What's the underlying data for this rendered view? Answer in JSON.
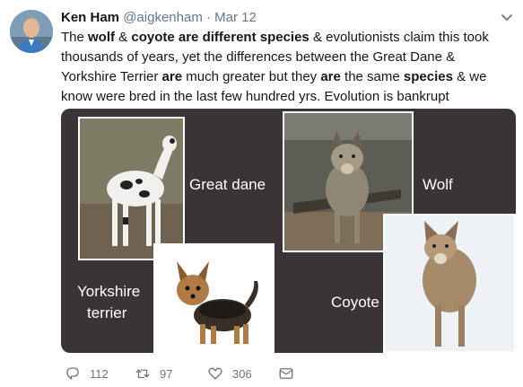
{
  "author": {
    "name": "Ken Ham",
    "handle": "@aigkenham",
    "separator": "·",
    "date": "Mar 12"
  },
  "tweet": {
    "segments": [
      {
        "text": "The ",
        "bold": false
      },
      {
        "text": "wolf",
        "bold": true
      },
      {
        "text": " & ",
        "bold": false
      },
      {
        "text": "coyote are different species",
        "bold": true
      },
      {
        "text": " & evolutionists claim this took thousands of years, yet the differences between the Great Dane & Yorkshire Terrier ",
        "bold": false
      },
      {
        "text": "are",
        "bold": true
      },
      {
        "text": " much greater but they ",
        "bold": false
      },
      {
        "text": "are",
        "bold": true
      },
      {
        "text": " the same ",
        "bold": false
      },
      {
        "text": "species",
        "bold": true
      },
      {
        "text": " & we know were bred in the last few hundred yrs.  Evolution is bankrupt",
        "bold": false
      }
    ]
  },
  "media": {
    "labels": {
      "great_dane": "Great dane",
      "wolf": "Wolf",
      "yorkshire_line1": "Yorkshire",
      "yorkshire_line2": "terrier",
      "coyote": "Coyote"
    }
  },
  "actions": {
    "replies": "112",
    "retweets": "97",
    "likes": "306"
  },
  "colors": {
    "text": "#14171a",
    "muted": "#657786",
    "media_bg": "#3a3436"
  },
  "icons": [
    "chevron-down-icon",
    "reply-icon",
    "retweet-icon",
    "like-icon",
    "message-icon"
  ]
}
